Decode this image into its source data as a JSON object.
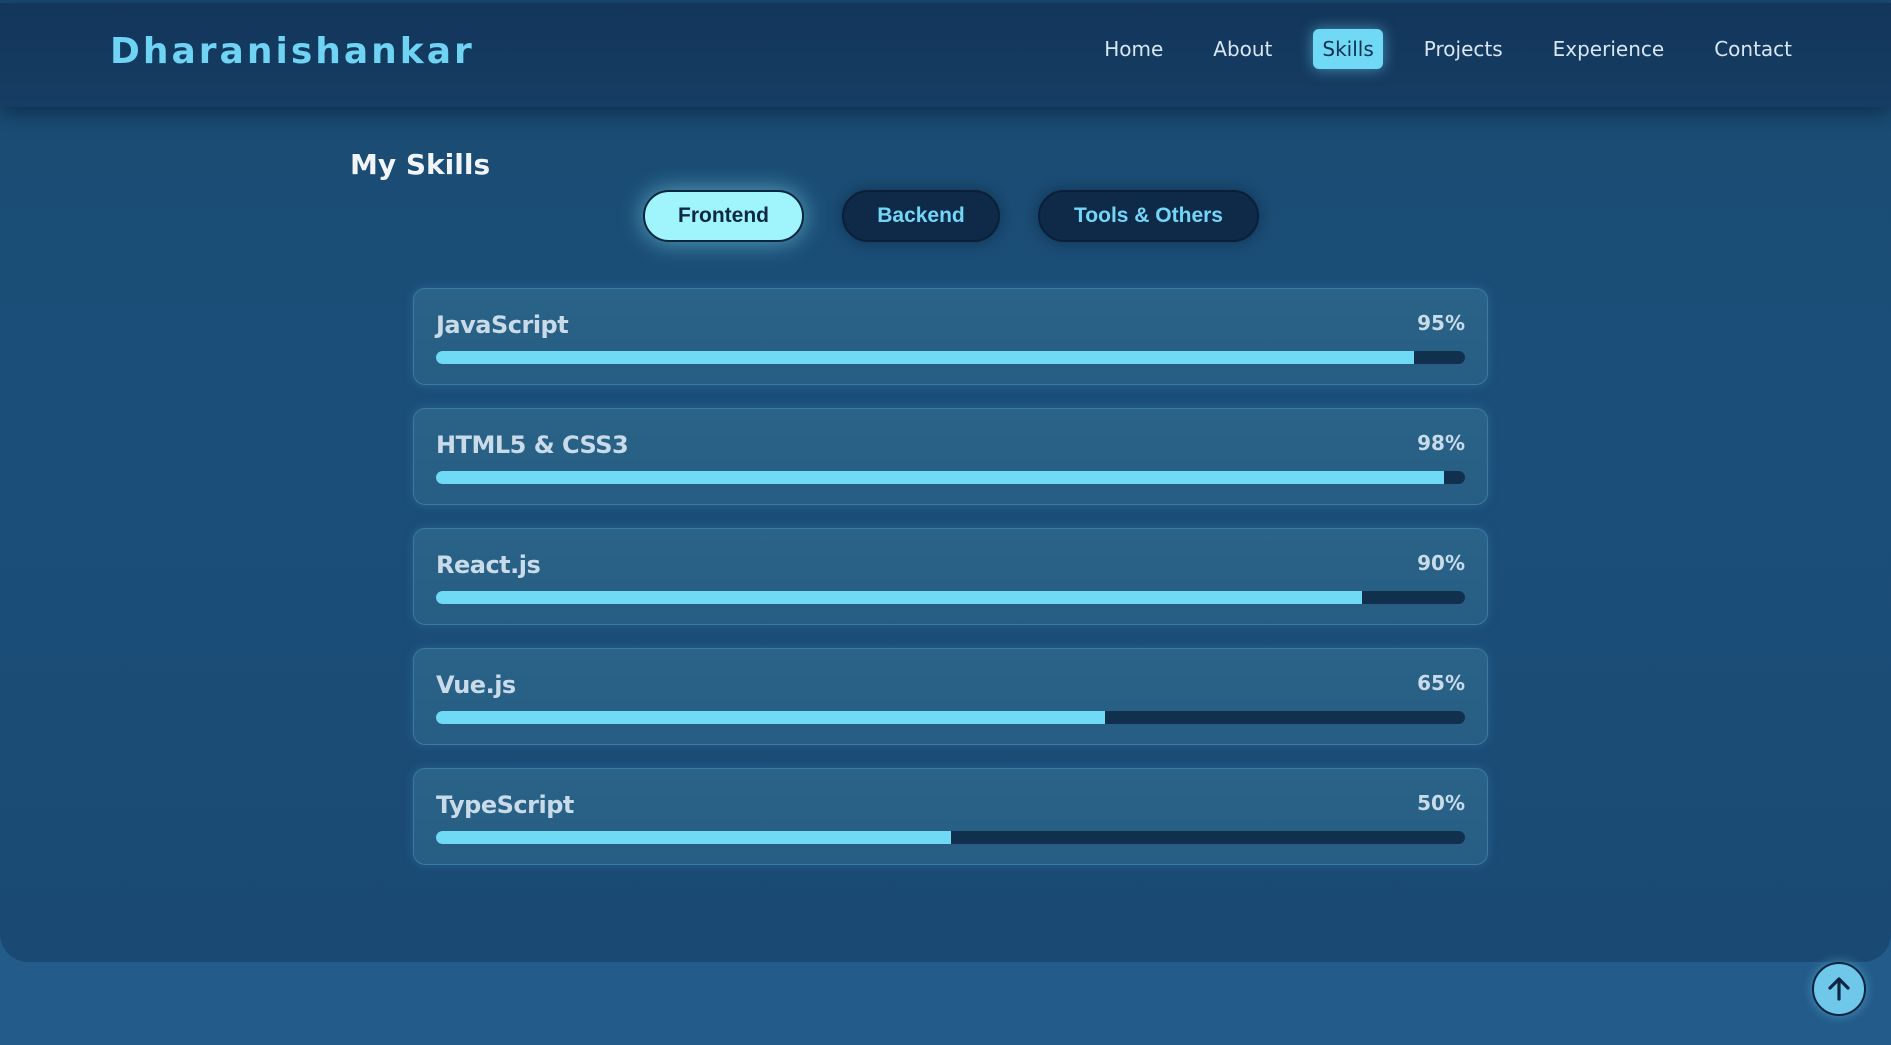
{
  "navbar": {
    "brand": "Dharanishankar",
    "links": [
      {
        "label": "Home",
        "active": false
      },
      {
        "label": "About",
        "active": false
      },
      {
        "label": "Skills",
        "active": true
      },
      {
        "label": "Projects",
        "active": false
      },
      {
        "label": "Experience",
        "active": false
      },
      {
        "label": "Contact",
        "active": false
      }
    ]
  },
  "skills_section": {
    "title": "My Skills",
    "tabs": [
      {
        "label": "Frontend",
        "active": true
      },
      {
        "label": "Backend",
        "active": false
      },
      {
        "label": "Tools & Others",
        "active": false
      }
    ],
    "skills": [
      {
        "name": "JavaScript",
        "percent_label": "95%",
        "level": 95
      },
      {
        "name": "HTML5 & CSS3",
        "percent_label": "98%",
        "level": 98
      },
      {
        "name": "React.js",
        "percent_label": "90%",
        "level": 90
      },
      {
        "name": "Vue.js",
        "percent_label": "65%",
        "level": 65
      },
      {
        "name": "TypeScript",
        "percent_label": "50%",
        "level": 50
      }
    ]
  },
  "scroll_top": {
    "icon": "arrow-up-icon"
  },
  "colors": {
    "accent": "#6fd9f6",
    "brand": "#6fd3f3",
    "background": "#1b4f79",
    "bar_track": "#11304e"
  }
}
